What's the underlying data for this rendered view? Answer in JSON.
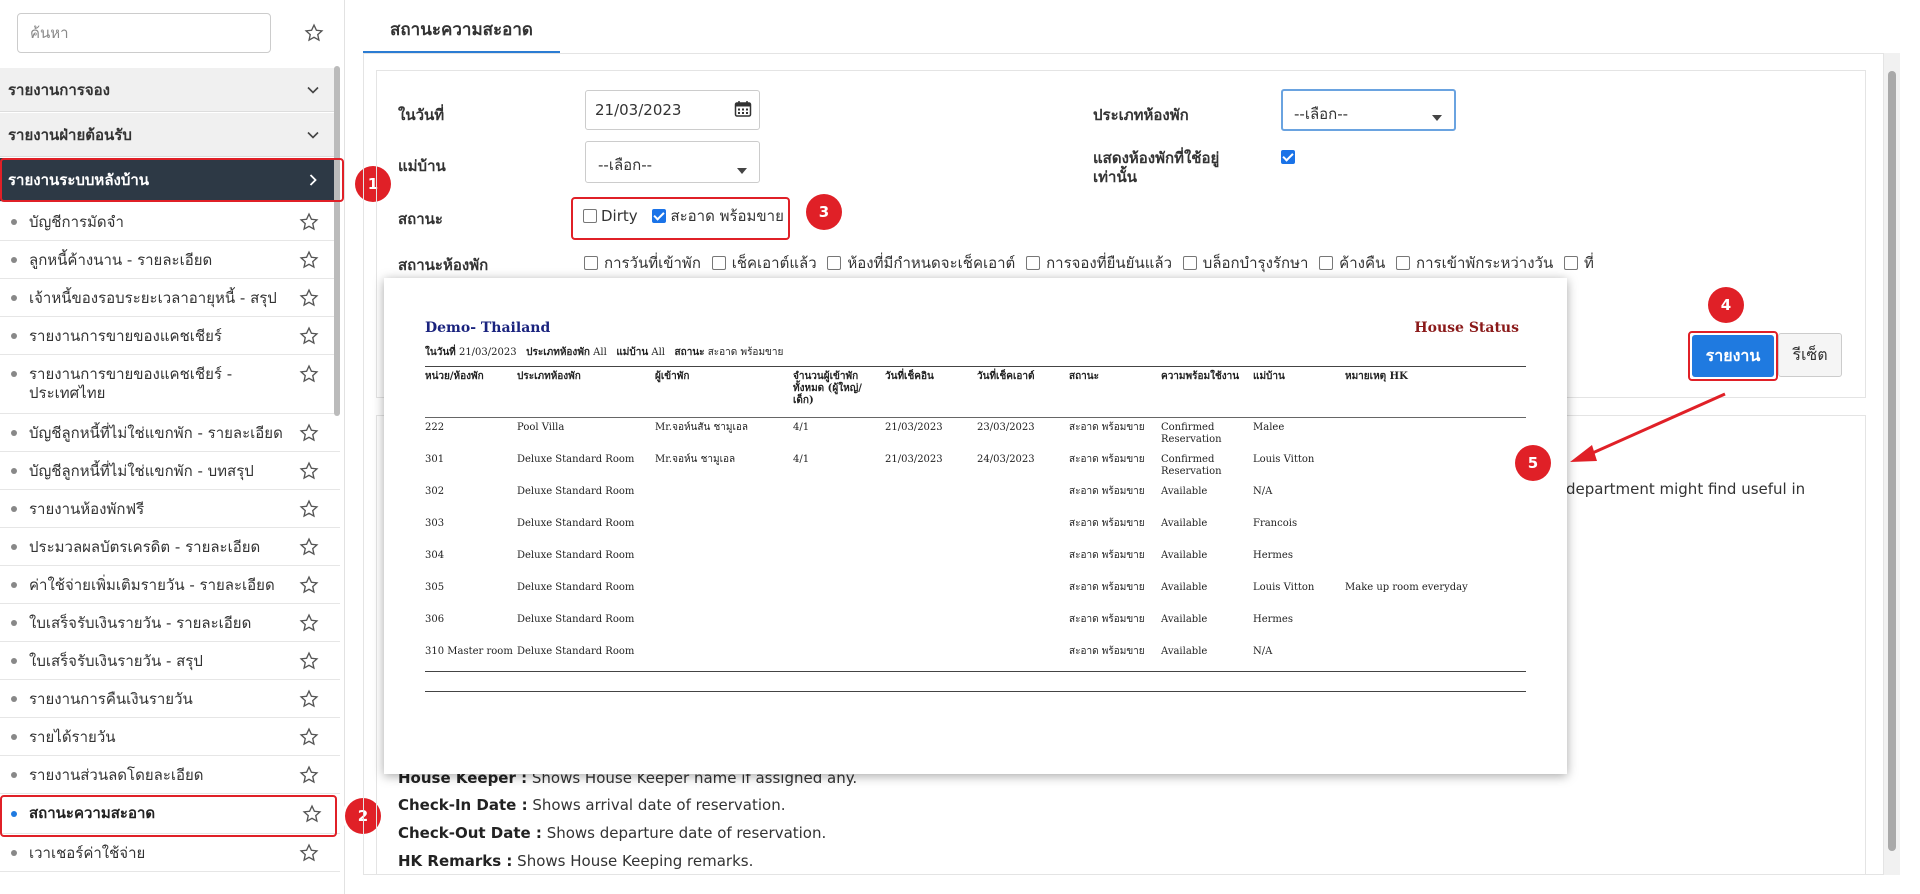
{
  "sidebar": {
    "search_placeholder": "ค้นหา",
    "groups": [
      {
        "label": "รายงานการจอง"
      },
      {
        "label": "รายงานฝ่ายต้อนรับ"
      },
      {
        "label": "รายงานระบบหลังบ้าน"
      }
    ],
    "items": [
      {
        "label": "บัญชีการมัดจำ"
      },
      {
        "label": "ลูกหนี้ค้างนาน - รายละเอียด"
      },
      {
        "label": "เจ้าหนี้ของรอบระยะเวลาอายุหนี้ - สรุป"
      },
      {
        "label": "รายงานการขายของแคชเชียร์"
      },
      {
        "label": "รายงานการขายของแคชเชียร์ - ประเทศไทย"
      },
      {
        "label": "บัญชีลูกหนี้ที่ไม่ใช่แขกพัก - รายละเอียด"
      },
      {
        "label": "บัญชีลูกหนี้ที่ไม่ใช่แขกพัก - บทสรุป"
      },
      {
        "label": "รายงานห้องพักฟรี"
      },
      {
        "label": "ประมวลผลบัตรเครดิต - รายละเอียด"
      },
      {
        "label": "ค่าใช้จ่ายเพิ่มเติมรายวัน - รายละเอียด"
      },
      {
        "label": "ใบเสร็จรับเงินรายวัน - รายละเอียด"
      },
      {
        "label": "ใบเสร็จรับเงินรายวัน - สรุป"
      },
      {
        "label": "รายงานการคืนเงินรายวัน"
      },
      {
        "label": "รายได้รายวัน"
      },
      {
        "label": "รายงานส่วนลดโดยละเอียด"
      },
      {
        "label": "สถานะความสะอาด"
      },
      {
        "label": "เวาเชอร์ค่าใช้จ่าย"
      }
    ]
  },
  "badges": [
    "1",
    "2",
    "3",
    "4",
    "5"
  ],
  "tab": {
    "label": "สถานะความสะอาด"
  },
  "form": {
    "date_label": "ในวันที่",
    "date_value": "21/03/2023",
    "housekeeper_label": "แม่บ้าน",
    "housekeeper_value": "--เลือก--",
    "status_label": "สถานะ",
    "status_dirty": "Dirty",
    "status_clean": "สะอาด พร้อมขาย",
    "room_status_label": "สถานะห้องพัก",
    "room_status_options": [
      "การวันที่เข้าพัก",
      "เช็คเอาต์แล้ว",
      "ห้องที่มีกำหนดจะเช็คเอาต์",
      "การจองที่ยืนยันแล้ว",
      "บล็อกบำรุงรักษา",
      "ค้างคืน",
      "การเข้าพักระหว่างวัน",
      "ที่"
    ],
    "room_type_label": "ประเภทห้องพัก",
    "room_type_value": "--เลือก--",
    "show_used_label_1": "แสดงห้องพักที่ใช้อยู่",
    "show_used_label_2": "เท่านั้น",
    "report_button": "รายงาน",
    "reset_button": "รีเซ็ต"
  },
  "descriptions": {
    "fragment": "department might find useful in",
    "lines": [
      {
        "key": "House Keeper :",
        "text": " Shows House Keeper name if assigned any."
      },
      {
        "key": "Check-In Date :",
        "text": " Shows arrival date of reservation."
      },
      {
        "key": "Check-Out Date :",
        "text": " Shows departure date of reservation."
      },
      {
        "key": "HK Remarks :",
        "text": " Shows House Keeping remarks."
      }
    ]
  },
  "report": {
    "company": "Demo- Thailand",
    "title": "House Status",
    "filter_date_label": "ในวันที่",
    "filter_date": "21/03/2023",
    "filter_roomtype_label": "ประเภทห้องพัก",
    "filter_roomtype": "All",
    "filter_hk_label": "แม่บ้าน",
    "filter_hk": "All",
    "filter_status_label": "สถานะ",
    "filter_status": "สะอาด พร้อมขาย",
    "columns": [
      "หน่วย/ห้องพัก",
      "ประเภทห้องพัก",
      "ผู้เข้าพัก",
      "จำนวนผู้เข้าพักทั้งหมด (ผู้ใหญ่/เด็ก)",
      "วันที่เช็คอิน",
      "วันที่เช็คเอาต์",
      "สถานะ",
      "ความพร้อมใช้งาน",
      "แม่บ้าน",
      "หมายเหตุ HK"
    ],
    "rows": [
      [
        "222",
        "Pool Villa",
        "Mr.จอห์นสัน ชามูเอล",
        "4/1",
        "21/03/2023",
        "23/03/2023",
        "สะอาด พร้อมขาย",
        "Confirmed Reservation",
        "Malee",
        ""
      ],
      [
        "301",
        "Deluxe Standard Room",
        "Mr.จอห์น ชามูเอล",
        "4/1",
        "21/03/2023",
        "24/03/2023",
        "สะอาด พร้อมขาย",
        "Confirmed Reservation",
        "Louis Vitton",
        ""
      ],
      [
        "302",
        "Deluxe Standard Room",
        "",
        "",
        "",
        "",
        "สะอาด พร้อมขาย",
        "Available",
        "N/A",
        ""
      ],
      [
        "303",
        "Deluxe Standard Room",
        "",
        "",
        "",
        "",
        "สะอาด พร้อมขาย",
        "Available",
        "Francois",
        ""
      ],
      [
        "304",
        "Deluxe Standard Room",
        "",
        "",
        "",
        "",
        "สะอาด พร้อมขาย",
        "Available",
        "Hermes",
        ""
      ],
      [
        "305",
        "Deluxe Standard Room",
        "",
        "",
        "",
        "",
        "สะอาด พร้อมขาย",
        "Available",
        "Louis Vitton",
        "Make up room everyday"
      ],
      [
        "306",
        "Deluxe Standard Room",
        "",
        "",
        "",
        "",
        "สะอาด พร้อมขาย",
        "Available",
        "Hermes",
        ""
      ],
      [
        "310 Master room",
        "Deluxe Standard Room",
        "",
        "",
        "",
        "",
        "สะอาด พร้อมขาย",
        "Available",
        "N/A",
        ""
      ]
    ]
  },
  "colors": {
    "accent": "#1f7ae0",
    "highlight": "#e02027",
    "active_group": "#2d3945",
    "report_title": "#8b1a1a",
    "report_company": "#1a237e"
  }
}
